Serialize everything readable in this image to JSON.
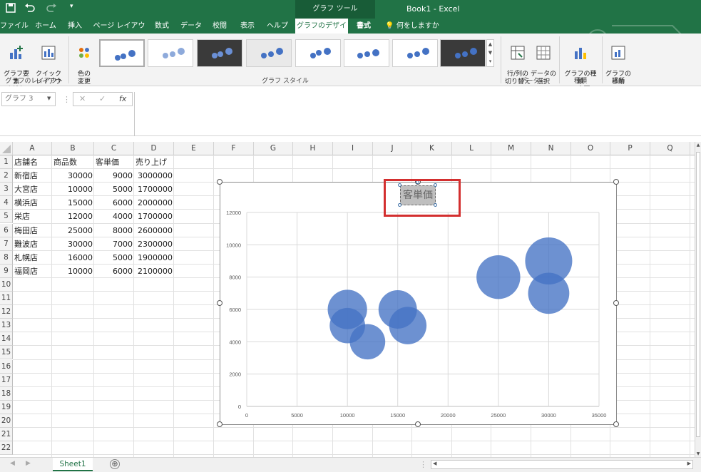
{
  "titlebar": {
    "save_icon": "save-icon",
    "undo_icon": "undo-icon",
    "redo_icon": "redo-icon",
    "customize_icon": "customize-icon",
    "tools_label": "グラフ ツール",
    "doc_title": "Book1  -  Excel"
  },
  "tabs": [
    "ファイル",
    "ホーム",
    "挿入",
    "ページ レイアウト",
    "数式",
    "データ",
    "校閲",
    "表示",
    "ヘルプ",
    "グラフのデザイン",
    "書式"
  ],
  "tell_me": "何をしますか",
  "ribbon": {
    "add_element": "グラフ要素\nを追加",
    "quick_layout": "クイック\nレイアウト",
    "layout_group": "グラフのレイアウト",
    "change_color": "色の\n変更",
    "styles_group": "グラフ スタイル",
    "switch_row_col": "行/列の\n切り替え",
    "select_data": "データの\n選択",
    "data_group": "データ",
    "change_type": "グラフの種類\nの変更",
    "type_group": "種類",
    "move_chart": "グラフの\n移動",
    "location_group": "場所"
  },
  "formula_bar": {
    "name_box": "グラフ 3",
    "cancel": "✕",
    "enter": "✓",
    "fx": "fx"
  },
  "columns": [
    "A",
    "B",
    "C",
    "D",
    "E",
    "F",
    "G",
    "H",
    "I",
    "J",
    "K",
    "L",
    "M",
    "N",
    "O",
    "P",
    "Q"
  ],
  "rows": [
    "1",
    "2",
    "3",
    "4",
    "5",
    "6",
    "7",
    "8",
    "9",
    "10",
    "11",
    "12",
    "13",
    "14",
    "15",
    "16",
    "17",
    "18",
    "19",
    "20",
    "21",
    "22"
  ],
  "table": {
    "headers": [
      "店舗名",
      "商品数",
      "客単価",
      "売り上げ"
    ],
    "rows": [
      [
        "新宿店",
        "30000",
        "9000",
        "3000000"
      ],
      [
        "大宮店",
        "10000",
        "5000",
        "1700000"
      ],
      [
        "横浜店",
        "15000",
        "6000",
        "2000000"
      ],
      [
        "栄店",
        "12000",
        "4000",
        "1700000"
      ],
      [
        "梅田店",
        "25000",
        "8000",
        "2600000"
      ],
      [
        "難波店",
        "30000",
        "7000",
        "2300000"
      ],
      [
        "札幌店",
        "16000",
        "5000",
        "1900000"
      ],
      [
        "福岡店",
        "10000",
        "6000",
        "2100000"
      ]
    ]
  },
  "chart_data": {
    "type": "scatter",
    "title": "客単価",
    "series": [
      {
        "name": "",
        "x": [
          30000,
          10000,
          15000,
          12000,
          25000,
          30000,
          16000,
          10000
        ],
        "y": [
          9000,
          5000,
          6000,
          4000,
          8000,
          7000,
          5000,
          6000
        ],
        "size": [
          3000000,
          1700000,
          2000000,
          1700000,
          2600000,
          2300000,
          1900000,
          2100000
        ]
      }
    ],
    "xlim": [
      0,
      35000
    ],
    "ylim": [
      0,
      12000
    ],
    "xticks": [
      "0",
      "5000",
      "10000",
      "15000",
      "20000",
      "25000",
      "30000",
      "35000"
    ],
    "yticks": [
      "0",
      "2000",
      "4000",
      "6000",
      "8000",
      "10000",
      "12000"
    ],
    "grid": "vertical and horizontal",
    "bubble_color": "#4472c4"
  },
  "sheet": {
    "tab": "Sheet1",
    "add": "⊕"
  },
  "colors": {
    "accent": "#217346",
    "highlight": "#d32f2f"
  }
}
